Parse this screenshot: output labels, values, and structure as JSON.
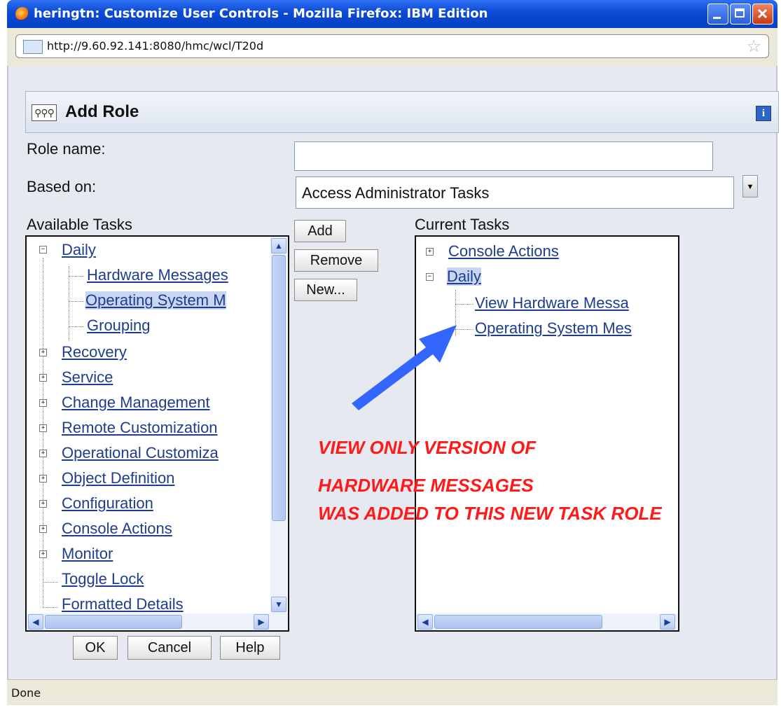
{
  "window": {
    "title": "heringtn: Customize User Controls - Mozilla Firefox: IBM Edition",
    "url": "http://9.60.92.141:8080/hmc/wcl/T20d",
    "status": "Done"
  },
  "dialog": {
    "title": "Add Role",
    "info_icon_glyph": "i",
    "role_name_label": "Role name:",
    "role_name_value": "",
    "based_on_label": "Based on:",
    "based_on_value": "Access Administrator Tasks"
  },
  "available_tasks": {
    "label": "Available Tasks",
    "items": [
      "Daily",
      "Hardware Messages",
      "Operating System M",
      "Grouping",
      "Recovery",
      "Service",
      "Change Management",
      "Remote Customization",
      "Operational Customiza",
      "Object Definition",
      "Configuration",
      "Console Actions",
      "Monitor",
      "Toggle Lock",
      "Formatted Details"
    ]
  },
  "buttons": {
    "add": "Add",
    "remove": "Remove",
    "new": "New...",
    "ok": "OK",
    "cancel": "Cancel",
    "help": "Help"
  },
  "current_tasks": {
    "label": "Current Tasks",
    "items": [
      "Console Actions",
      "Daily",
      "View Hardware Messa",
      "Operating System Mes"
    ]
  },
  "annotation": {
    "line1": "VIEW ONLY VERSION OF",
    "line2": "HARDWARE MESSAGES",
    "line3": "WAS ADDED TO THIS NEW TASK ROLE",
    "text_color": "#ff1a1a",
    "arrow_color": "#3366ff"
  },
  "colors": {
    "titlebar": "#0a4ad4",
    "link": "#1f3d8f",
    "selection": "#c9d6f2"
  }
}
